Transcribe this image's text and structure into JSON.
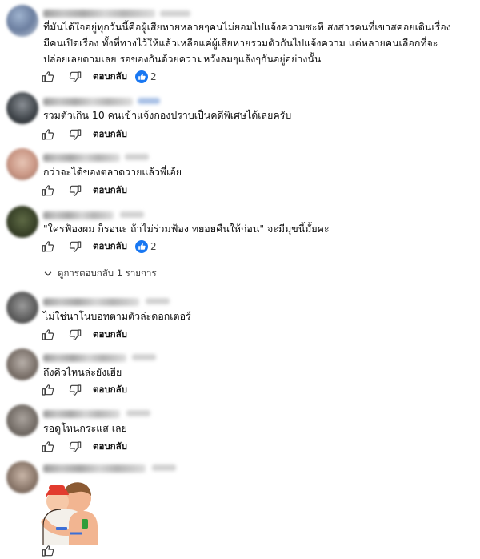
{
  "comments": [
    {
      "text": "ที่มันได้ใจอยู่ทุกวันนี้คือผู้เสียหายหลายๆคนไม่ยอมไปแจ้งความซะที สงสารคนที่เขาสคอยเดินเรื่อง\nมีคนเปิดเรื่อง ทั้งที่ทางไว้ให้แล้วเหลือแค่ผู้เสียหายรวมตัวกันไปแจ้งความ แต่หลายคนเลือกที่จะ\nปล่อยเลยตามเลย รอของกันด้วยความหวังลมๆแล้งๆกันอยู่อย่างนั้น",
      "reply_label": "ตอบกลับ",
      "reactions": "2"
    },
    {
      "text": "รวมตัวเกิน 10 คนเข้าแจ้งกองปราบเป็นคดีพิเศษได้เลยครับ",
      "reply_label": "ตอบกลับ"
    },
    {
      "text": "กว่าจะได้ของตลาดวายแล้วพี่เอ้ย",
      "reply_label": "ตอบกลับ"
    },
    {
      "text": "\"ใครฟ้องผม ก็รอนะ ถ้าไม่ร่วมฟ้อง ทยอยคืนให้ก่อน\" จะมีมุขนี้มั้ยคะ",
      "reply_label": "ตอบกลับ",
      "reactions": "2",
      "replies_label": "ดูการตอบกลับ 1 รายการ"
    },
    {
      "text": "ไม่ใช่นาโนบอทตามตัวล่ะดอกเตอร์",
      "reply_label": "ตอบกลับ"
    },
    {
      "text": "ถึงคิวไหนล่ะยังเฮีย",
      "reply_label": "ตอบกลับ"
    },
    {
      "text": "รอดูโหนกระแส เลย",
      "reply_label": "ตอบกลับ"
    },
    {
      "text": "",
      "reply_label": ""
    }
  ],
  "colors": {
    "reaction_blue": "#1877f2",
    "action_gray": "#606060"
  },
  "icons": {
    "like": "thumbs-up-icon",
    "dislike": "thumbs-down-icon",
    "reaction": "like-reaction-icon",
    "chevron": "chevron-down-icon",
    "sticker": "hug-sticker"
  }
}
